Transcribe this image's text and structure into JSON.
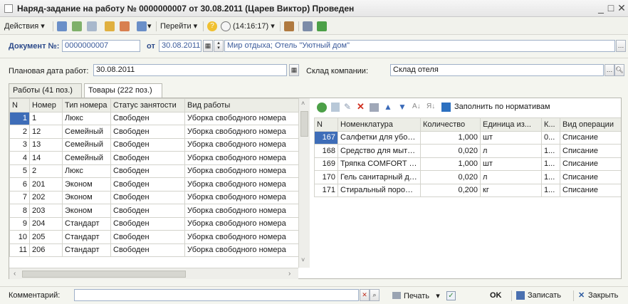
{
  "window": {
    "title": "Наряд-задание на работу № 0000000007 от 30.08.2011 (Царев Виктор) Проведен"
  },
  "toolbar": {
    "actions": "Действия",
    "goto": "Перейти",
    "time": "(14:16:17)"
  },
  "doc": {
    "label": "Документ №:",
    "number": "0000000007",
    "from": "от",
    "date": "30.08.2011",
    "place": "Мир отдыха; Отель \"Уютный дом\""
  },
  "plan": {
    "label": "Плановая дата работ:",
    "date": "30.08.2011"
  },
  "stock": {
    "label": "Склад компании:",
    "value": "Склад отеля"
  },
  "tabs": [
    "Работы (41 поз.)",
    "Товары (222 поз.)"
  ],
  "left_table": {
    "columns": [
      "N",
      "Номер",
      "Тип номера",
      "Статус занятости",
      "Вид работы"
    ],
    "rows": [
      [
        "1",
        "1",
        "Люкс",
        "Свободен",
        "Уборка свободного номера"
      ],
      [
        "2",
        "12",
        "Семейный",
        "Свободен",
        "Уборка свободного номера"
      ],
      [
        "3",
        "13",
        "Семейный",
        "Свободен",
        "Уборка свободного номера"
      ],
      [
        "4",
        "14",
        "Семейный",
        "Свободен",
        "Уборка свободного номера"
      ],
      [
        "5",
        "2",
        "Люкс",
        "Свободен",
        "Уборка свободного номера"
      ],
      [
        "6",
        "201",
        "Эконом",
        "Свободен",
        "Уборка свободного номера"
      ],
      [
        "7",
        "202",
        "Эконом",
        "Свободен",
        "Уборка свободного номера"
      ],
      [
        "8",
        "203",
        "Эконом",
        "Свободен",
        "Уборка свободного номера"
      ],
      [
        "9",
        "204",
        "Стандарт",
        "Свободен",
        "Уборка свободного номера"
      ],
      [
        "10",
        "205",
        "Стандарт",
        "Свободен",
        "Уборка свободного номера"
      ],
      [
        "11",
        "206",
        "Стандарт",
        "Свободен",
        "Уборка свободного номера"
      ]
    ]
  },
  "right_toolbar": {
    "fill": "Заполнить по нормативам"
  },
  "right_table": {
    "columns": [
      "N",
      "Номенклатура",
      "Количество",
      "Единица из...",
      "К...",
      "Вид операции"
    ],
    "rows": [
      [
        "167",
        "Салфетки для уборки...",
        "1,000",
        "шт",
        "0...",
        "Списание"
      ],
      [
        "168",
        "Средство для мытья ...",
        "0,020",
        "л",
        "1...",
        "Списание"
      ],
      [
        "169",
        "Тряпка COMFORT ун...",
        "1,000",
        "шт",
        "1...",
        "Списание"
      ],
      [
        "170",
        "Гель санитарный для...",
        "0,020",
        "л",
        "1...",
        "Списание"
      ],
      [
        "171",
        "Стиральный порошок",
        "0,200",
        "кг",
        "1...",
        "Списание"
      ]
    ]
  },
  "bottom": {
    "comment_label": "Комментарий:",
    "print": "Печать",
    "ok": "OK",
    "save": "Записать",
    "close": "Закрыть"
  }
}
